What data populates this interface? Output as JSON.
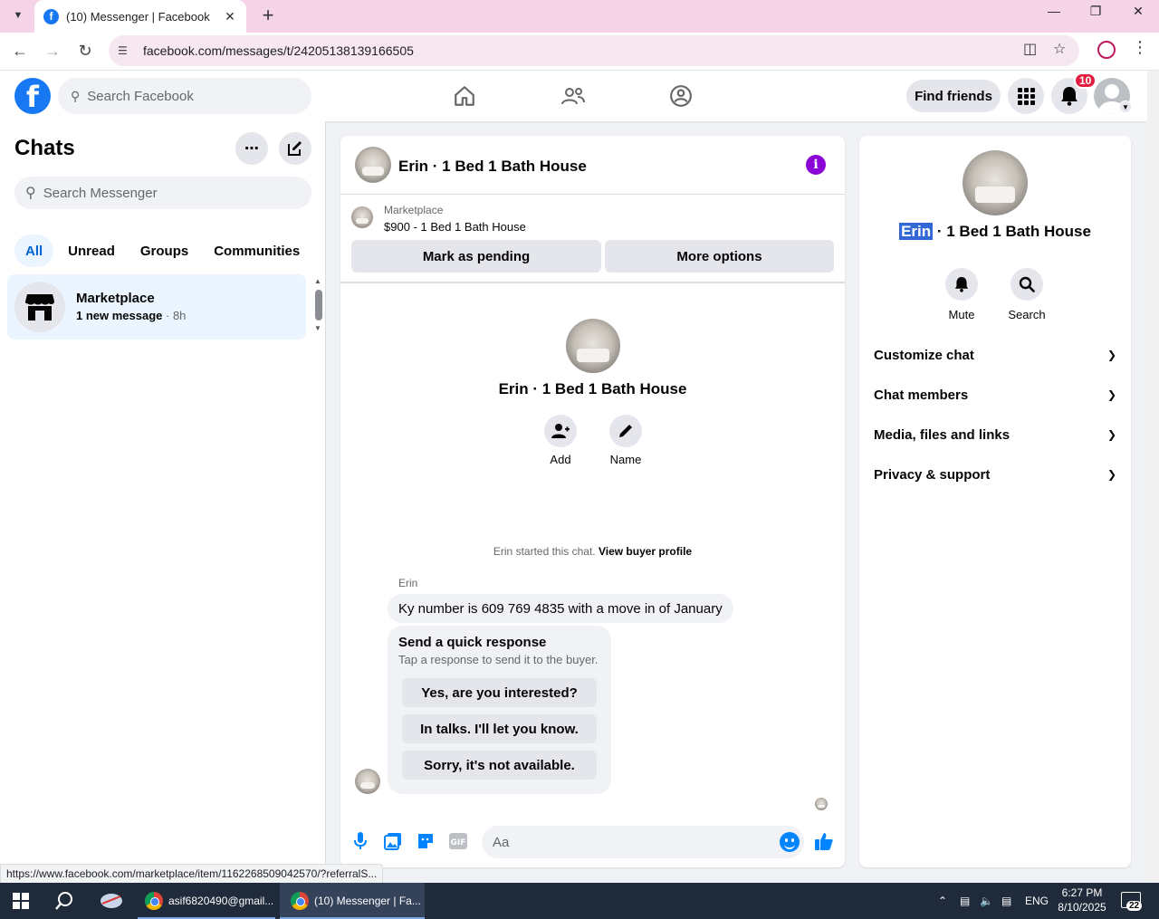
{
  "browser": {
    "tab_title": "(10) Messenger | Facebook",
    "url": "facebook.com/messages/t/24205138139166505",
    "status_url": "https://www.facebook.com/marketplace/item/1162268509042570/?referralS..."
  },
  "header": {
    "search_placeholder": "Search Facebook",
    "find_friends": "Find friends",
    "notification_count": "10"
  },
  "sidebar": {
    "title": "Chats",
    "search_placeholder": "Search Messenger",
    "filters": [
      "All",
      "Unread",
      "Groups",
      "Communities"
    ],
    "chat": {
      "name": "Marketplace",
      "preview": "1 new message",
      "time": " · 8h"
    }
  },
  "conversation": {
    "title": "Erin · 1 Bed 1 Bath House",
    "marketplace_label": "Marketplace",
    "listing": "$900 - 1 Bed 1 Bath House",
    "mark_pending": "Mark as pending",
    "more_options": "More options",
    "profile_name": "Erin · 1 Bed 1 Bath House",
    "add_label": "Add",
    "name_label": "Name",
    "started_text": "Erin started this chat. ",
    "view_buyer_profile": "View buyer profile",
    "sender": "Erin",
    "message": "Ky number is 609 769 4835 with a move in of January",
    "quick_title": "Send a quick response",
    "quick_subtitle": "Tap a response to send it to the buyer.",
    "quick_responses": [
      "Yes, are you interested?",
      "In talks. I'll let you know.",
      "Sorry, it's not available."
    ],
    "composer_placeholder": "Aa"
  },
  "details": {
    "name_highlight": "Erin",
    "name_rest": " · 1 Bed 1 Bath House",
    "mute": "Mute",
    "search": "Search",
    "sections": [
      "Customize chat",
      "Chat members",
      "Media, files and links",
      "Privacy & support"
    ]
  },
  "taskbar": {
    "app1": "asif6820490@gmail...",
    "app2": "(10) Messenger | Fa...",
    "lang": "ENG",
    "time": "6:27 PM",
    "date": "8/10/2025",
    "notif_count": "22"
  },
  "colors": {
    "brand": "#1877f2",
    "accent_purple": "#8a05d6",
    "active_filter": "#0064d1",
    "messenger_blue": "#0084ff"
  }
}
